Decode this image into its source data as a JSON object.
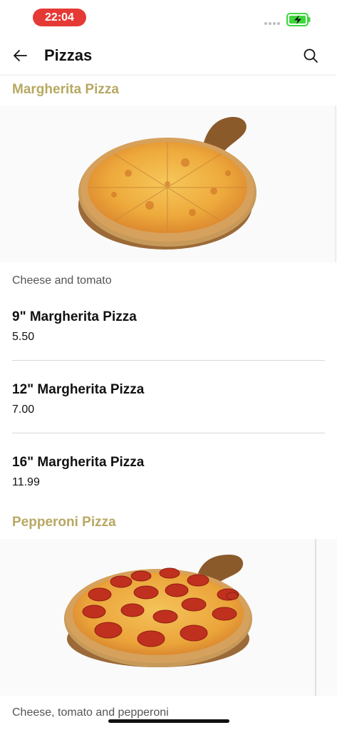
{
  "status_bar": {
    "time": "22:04",
    "battery_icon": "battery-charging-icon"
  },
  "header": {
    "title": "Pizzas",
    "back_icon": "back-arrow-icon",
    "search_icon": "search-icon"
  },
  "sections": [
    {
      "title": "Margherita Pizza",
      "description": "Cheese and tomato",
      "items": [
        {
          "name": "9\" Margherita Pizza",
          "price": "5.50"
        },
        {
          "name": "12\" Margherita Pizza",
          "price": "7.00"
        },
        {
          "name": "16\" Margherita Pizza",
          "price": "11.99"
        }
      ]
    },
    {
      "title": "Pepperoni Pizza",
      "description": "Cheese, tomato and pepperoni"
    }
  ],
  "colors": {
    "accent": "#b7a862",
    "time_pill": "#e53935",
    "battery": "#3dd63d"
  }
}
